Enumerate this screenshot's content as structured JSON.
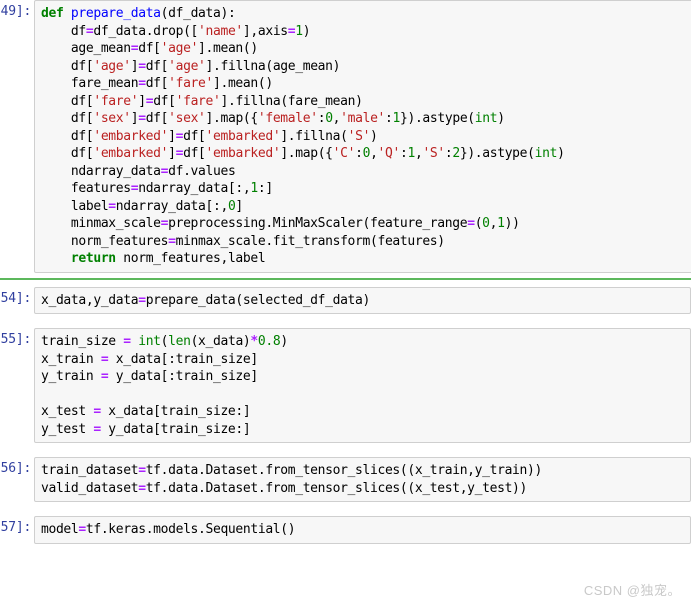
{
  "notebook": {
    "watermark": "CSDN @独宠。",
    "colors": {
      "keyword": "#008000",
      "function": "#0000FF",
      "string": "#BA2121",
      "number": "#008000",
      "operator": "#AA22FF",
      "builtin": "#008000",
      "prompt": "#303F9F",
      "cell_background": "#f7f7f7",
      "cell_border": "#cfcfcf",
      "separator": "#5cb85c",
      "watermark": "#c9c9c9"
    },
    "cells": [
      {
        "prompt": "[49]:",
        "lines": [
          "def prepare_data(df_data):",
          "    df=df_data.drop(['name'],axis=1)",
          "    age_mean=df['age'].mean()",
          "    df['age']=df['age'].fillna(age_mean)",
          "    fare_mean=df['fare'].mean()",
          "    df['fare']=df['fare'].fillna(fare_mean)",
          "    df['sex']=df['sex'].map({'female':0,'male':1}).astype(int)",
          "    df['embarked']=df['embarked'].fillna('S')",
          "    df['embarked']=df['embarked'].map({'C':0,'Q':1,'S':2}).astype(int)",
          "    ndarray_data=df.values",
          "    features=ndarray_data[:,1:]",
          "    label=ndarray_data[:,0]",
          "    minmax_scale=preprocessing.MinMaxScaler(feature_range=(0,1))",
          "    norm_features=minmax_scale.fit_transform(features)",
          "    return norm_features,label"
        ]
      },
      {
        "prompt": "[54]:",
        "lines": [
          "x_data,y_data=prepare_data(selected_df_data)"
        ]
      },
      {
        "prompt": "[55]:",
        "lines": [
          "train_size = int(len(x_data)*0.8)",
          "x_train = x_data[:train_size]",
          "y_train = y_data[:train_size]",
          "",
          "x_test = x_data[train_size:]",
          "y_test = y_data[train_size:]"
        ]
      },
      {
        "prompt": "[56]:",
        "lines": [
          "train_dataset=tf.data.Dataset.from_tensor_slices((x_train,y_train))",
          "valid_dataset=tf.data.Dataset.from_tensor_slices((x_test,y_test))"
        ]
      },
      {
        "prompt": "[57]:",
        "lines": [
          "model=tf.keras.models.Sequential()"
        ]
      }
    ]
  }
}
